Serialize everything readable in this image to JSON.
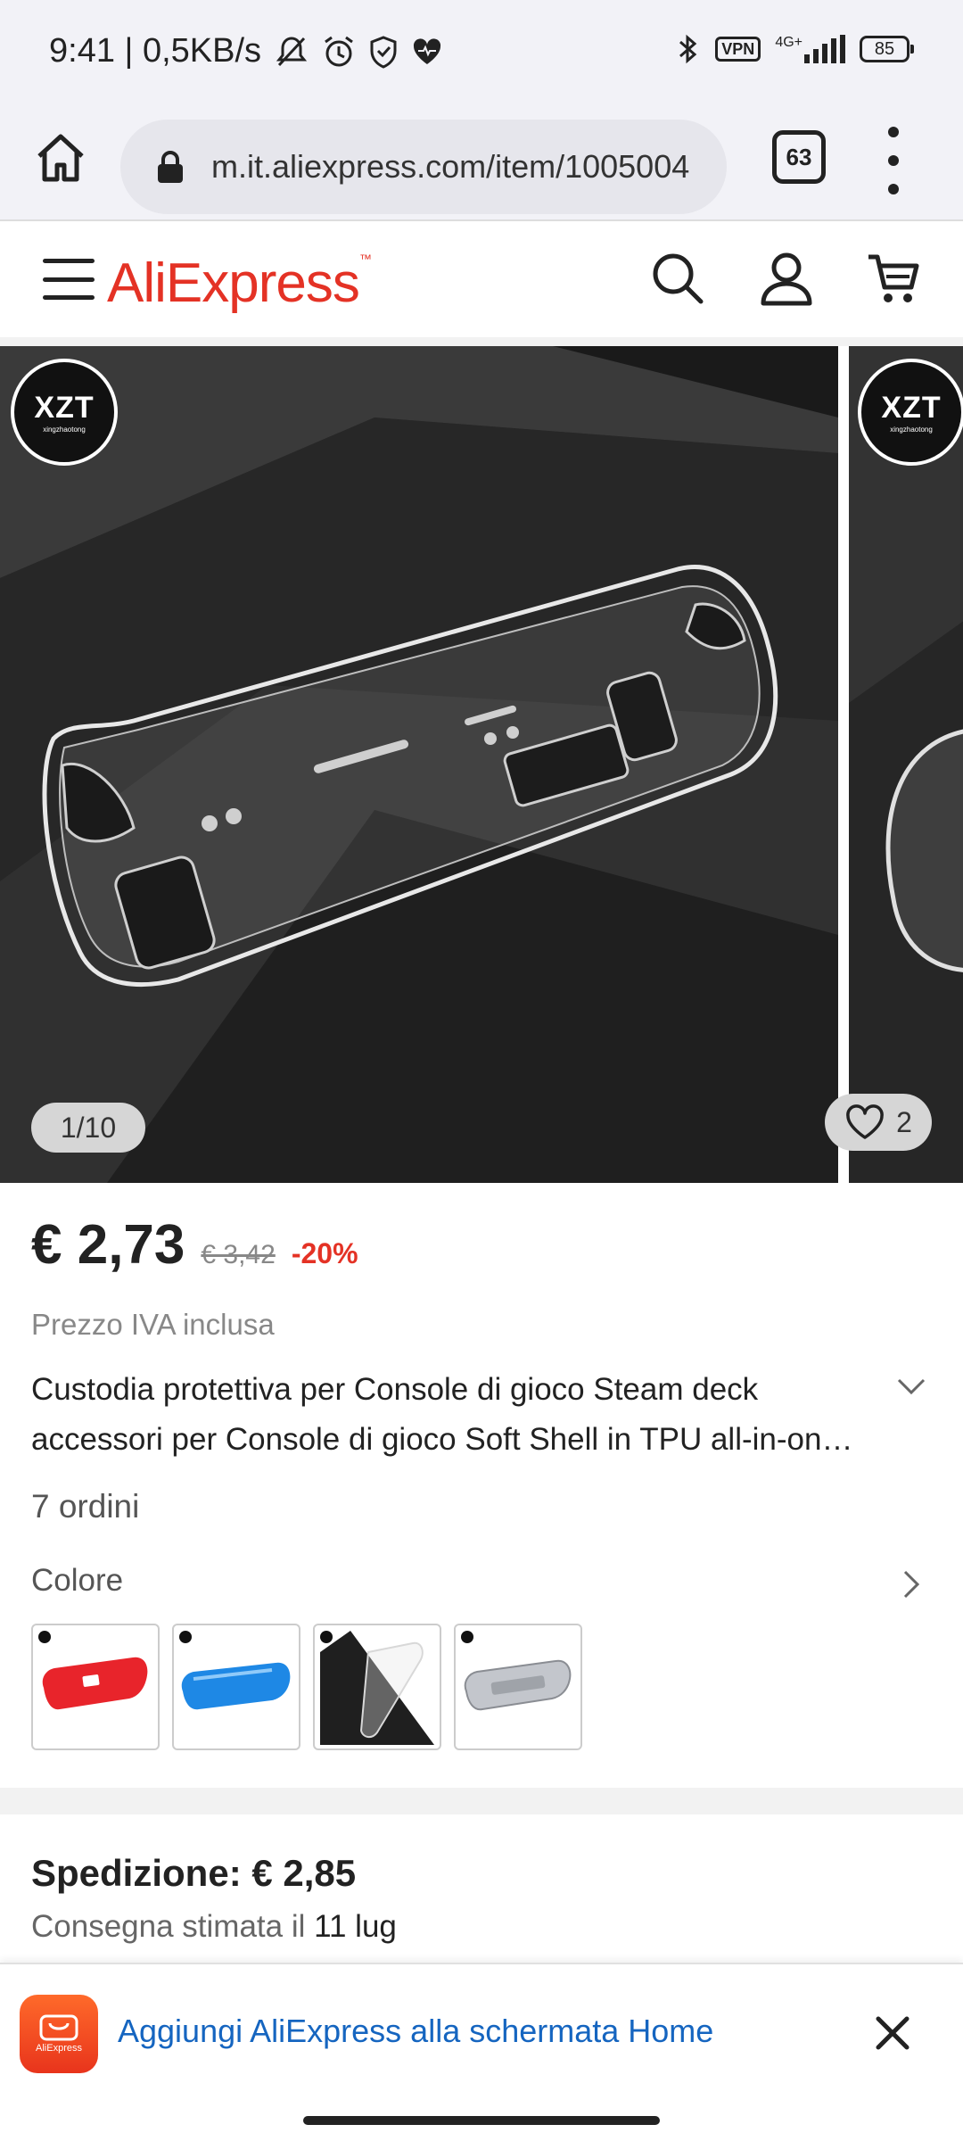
{
  "status_bar": {
    "time_speed": "9:41 | 0,5KB/s",
    "vpn": "VPN",
    "network": "4G+",
    "battery": "85"
  },
  "browser": {
    "url": "m.it.aliexpress.com/item/1005004",
    "tab_count": "63"
  },
  "site_header": {
    "logo": "AliExpress",
    "logo_tm": "™"
  },
  "gallery": {
    "brand_badge": "XZT",
    "brand_badge_sub": "xingzhaotong",
    "counter": "1/10",
    "likes": "2"
  },
  "product": {
    "price": "€ 2,73",
    "original_price": "€ 3,42",
    "discount": "-20%",
    "vat_note": "Prezzo IVA inclusa",
    "title": "Custodia protettiva per Console di gioco Steam deck accessori per Console di gioco Soft Shell in TPU all-in-on…",
    "orders": "7 ordini",
    "color_label": "Colore",
    "swatches": [
      {
        "name": "red",
        "color": "#e8242b"
      },
      {
        "name": "blue",
        "color": "#1e88e5"
      },
      {
        "name": "clear-dark",
        "color": "#2a2a2a"
      },
      {
        "name": "clear-gray",
        "color": "#b9bcc2"
      }
    ]
  },
  "shipping": {
    "title": "Spedizione: € 2,85",
    "estimate_prefix": "Consegna stimata il",
    "estimate_date": "11 lug"
  },
  "install_banner": {
    "app_label": "AliExpress",
    "text": "Aggiungi AliExpress alla schermata Home"
  },
  "colors": {
    "brand": "#e43225",
    "link": "#1565c0"
  }
}
